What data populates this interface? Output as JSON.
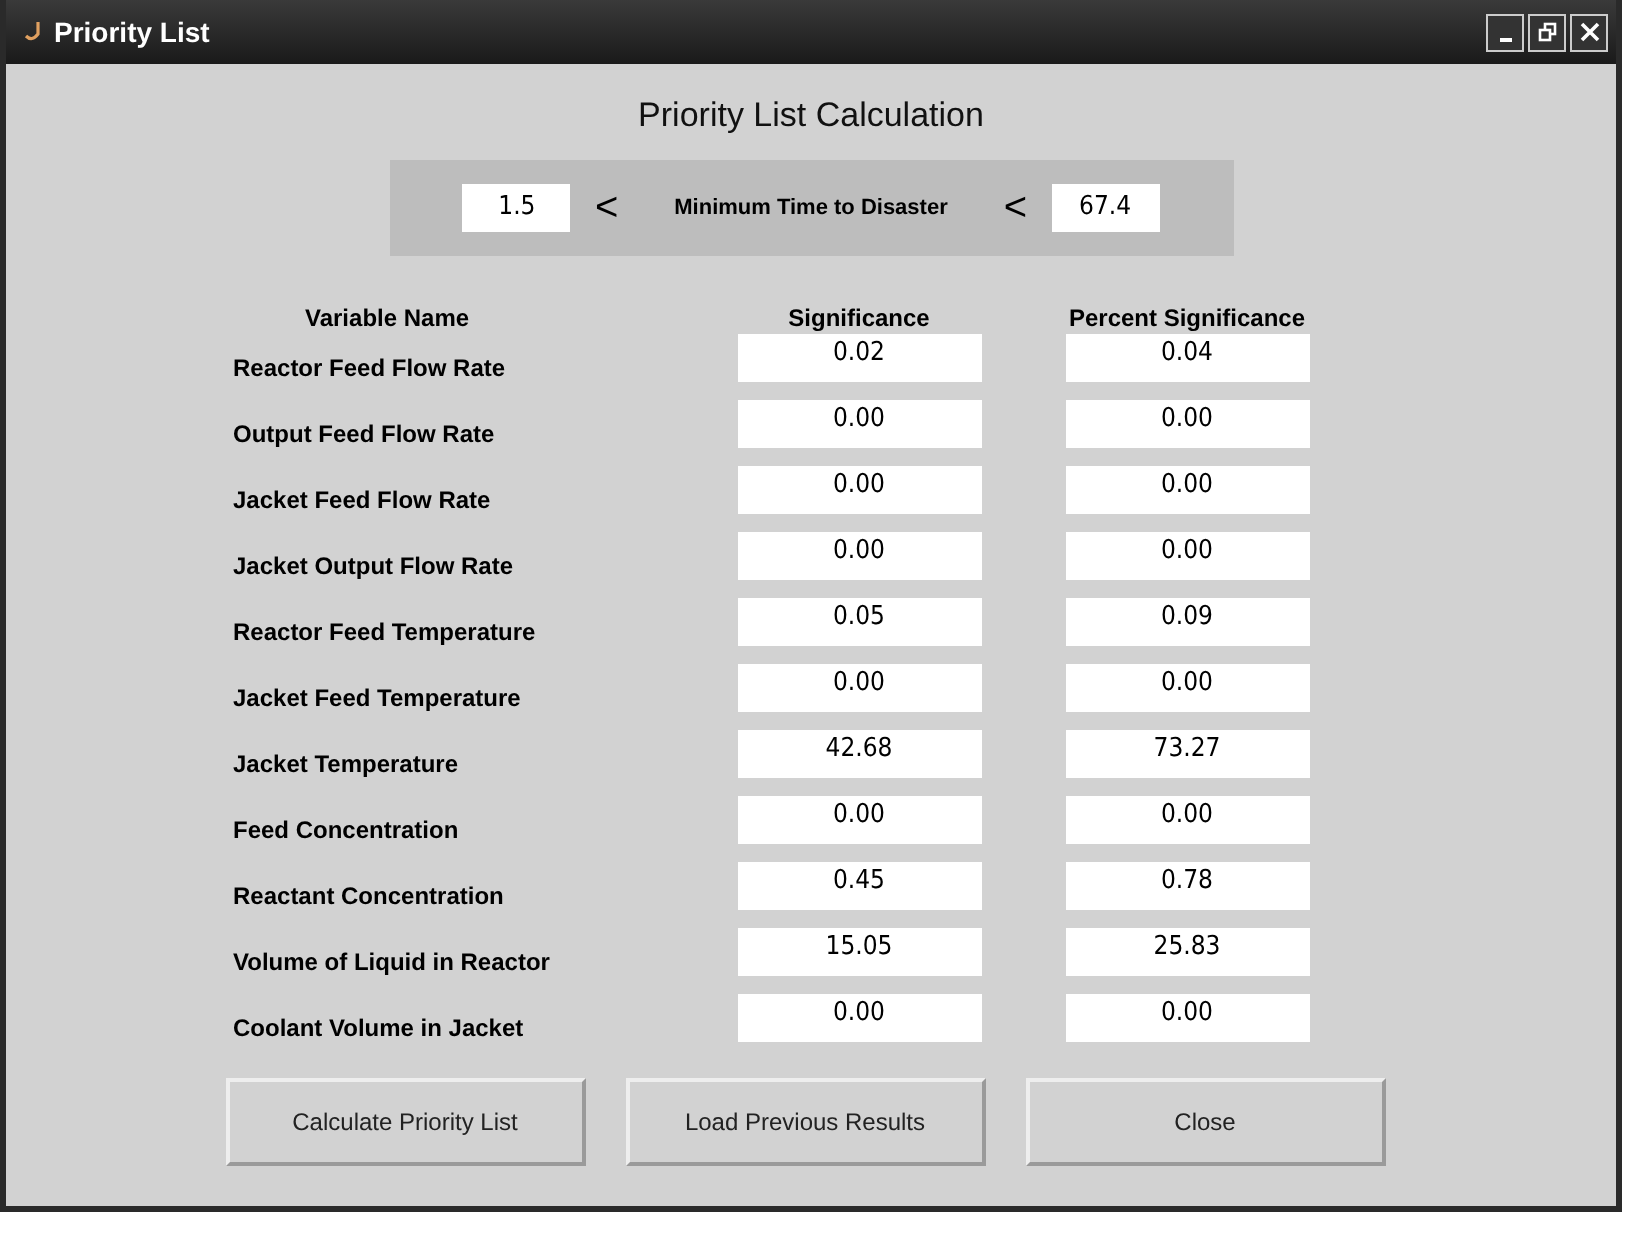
{
  "window": {
    "title": "Priority List"
  },
  "heading": "Priority List Calculation",
  "range": {
    "lower": "1.5",
    "lower_sign": "<",
    "label": "Minimum Time to Disaster",
    "upper_sign": "<",
    "upper": "67.4"
  },
  "table": {
    "columns": [
      "Variable Name",
      "Significance",
      "Percent Significance"
    ],
    "rows": [
      {
        "name": "Reactor Feed Flow Rate",
        "significance": "0.02",
        "percent": "0.04"
      },
      {
        "name": "Output Feed Flow Rate",
        "significance": "0.00",
        "percent": "0.00"
      },
      {
        "name": "Jacket Feed Flow Rate",
        "significance": "0.00",
        "percent": "0.00"
      },
      {
        "name": "Jacket Output Flow Rate",
        "significance": "0.00",
        "percent": "0.00"
      },
      {
        "name": "Reactor Feed Temperature",
        "significance": "0.05",
        "percent": "0.09"
      },
      {
        "name": "Jacket Feed Temperature",
        "significance": "0.00",
        "percent": "0.00"
      },
      {
        "name": "Jacket Temperature",
        "significance": "42.68",
        "percent": "73.27"
      },
      {
        "name": "Feed Concentration",
        "significance": "0.00",
        "percent": "0.00"
      },
      {
        "name": "Reactant Concentration",
        "significance": "0.45",
        "percent": "0.78"
      },
      {
        "name": "Volume of Liquid in Reactor",
        "significance": "15.05",
        "percent": "25.83"
      },
      {
        "name": "Coolant Volume in Jacket",
        "significance": "0.00",
        "percent": "0.00"
      }
    ]
  },
  "buttons": [
    "Calculate Priority List",
    "Load Previous Results",
    "Close"
  ]
}
